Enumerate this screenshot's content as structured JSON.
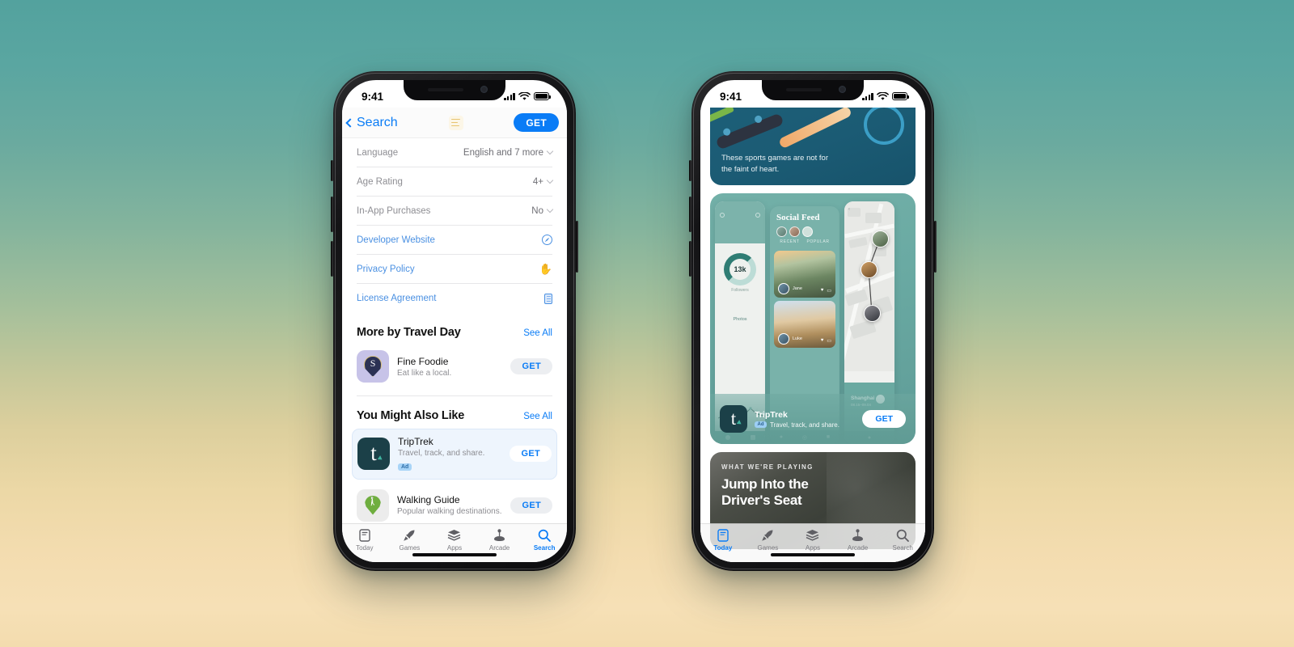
{
  "meta": {
    "background_top": "#53a29e",
    "background_bottom": "#f3dcae",
    "accent_blue": "#0a7cf6"
  },
  "left_phone": {
    "status": {
      "time": "9:41",
      "signal": "signal-icon",
      "wifi": "wifi-icon",
      "battery": "battery-icon"
    },
    "navbar": {
      "back_label": "Search",
      "app_icon": "list-app-icon",
      "get_label": "GET"
    },
    "info_rows": [
      {
        "label": "Language",
        "value": "English and 7 more"
      },
      {
        "label": "Age Rating",
        "value": "4+"
      },
      {
        "label": "In-App Purchases",
        "value": "No"
      }
    ],
    "link_rows": [
      {
        "label": "Developer Website",
        "icon": "compass-icon"
      },
      {
        "label": "Privacy Policy",
        "icon": "hand-icon"
      },
      {
        "label": "License Agreement",
        "icon": "document-icon"
      }
    ],
    "sections": [
      {
        "title": "More by Travel Day",
        "see_all": "See All",
        "apps": [
          {
            "name": "Fine Foodie",
            "subtitle": "Eat like a local.",
            "get_label": "GET",
            "icon": "fine-foodie-icon",
            "ad": ""
          }
        ]
      },
      {
        "title": "You Might Also Like",
        "see_all": "See All",
        "apps": [
          {
            "name": "TripTrek",
            "subtitle": "Travel, track, and share.",
            "get_label": "GET",
            "icon": "triptrek-icon",
            "ad": "Ad"
          },
          {
            "name": "Walking Guide",
            "subtitle": "Popular walking destinations.",
            "get_label": "GET",
            "icon": "walking-guide-icon",
            "ad": ""
          }
        ]
      }
    ],
    "tabs": [
      {
        "label": "Today",
        "icon": "today-icon",
        "active": false
      },
      {
        "label": "Games",
        "icon": "rocket-icon",
        "active": false
      },
      {
        "label": "Apps",
        "icon": "stack-icon",
        "active": false
      },
      {
        "label": "Arcade",
        "icon": "joystick-icon",
        "active": false
      },
      {
        "label": "Search",
        "icon": "search-icon",
        "active": true
      }
    ]
  },
  "right_phone": {
    "status": {
      "time": "9:41",
      "signal": "signal-icon",
      "wifi": "wifi-icon",
      "battery": "battery-icon"
    },
    "sports_card": {
      "caption_line1": "These sports games are not for",
      "caption_line2": "the faint of heart."
    },
    "trip_card": {
      "mock_social_title": "Social Feed",
      "mock_stat_value": "13k",
      "mock_stat_label": "Followers",
      "mock_photos_label": "Photos",
      "mock_tab_recent": "RECENT",
      "mock_tab_popular": "POPULAR",
      "mock_user_1": "Jane",
      "mock_user_2": "Luke",
      "mock_city": "Shanghai",
      "mock_city_sub": "08.15–09.04",
      "app_name": "TripTrek",
      "ad_badge": "Ad",
      "app_subtitle": "Travel, track, and share.",
      "get_label": "GET"
    },
    "playing_card": {
      "eyebrow": "WHAT WE'RE PLAYING",
      "title_line1": "Jump Into the",
      "title_line2": "Driver's Seat"
    },
    "tabs": [
      {
        "label": "Today",
        "icon": "today-icon",
        "active": true
      },
      {
        "label": "Games",
        "icon": "rocket-icon",
        "active": false
      },
      {
        "label": "Apps",
        "icon": "stack-icon",
        "active": false
      },
      {
        "label": "Arcade",
        "icon": "joystick-icon",
        "active": false
      },
      {
        "label": "Search",
        "icon": "search-icon",
        "active": false
      }
    ]
  }
}
